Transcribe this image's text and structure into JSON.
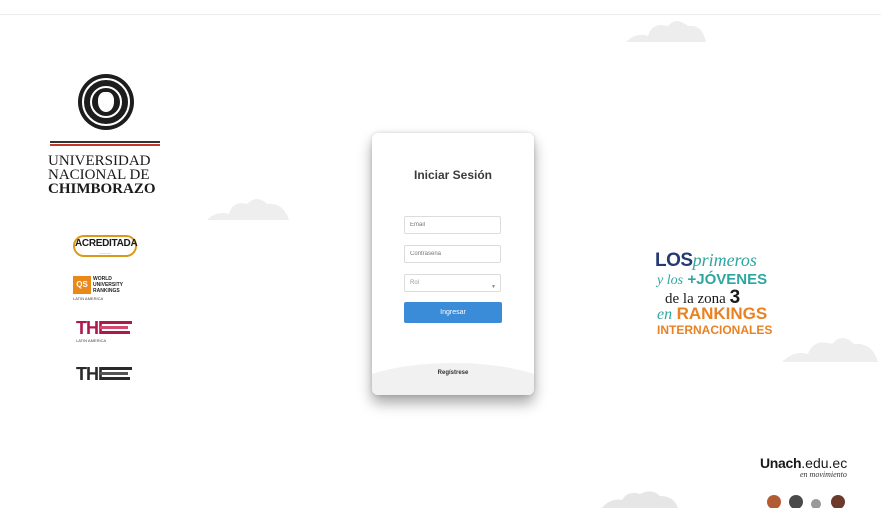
{
  "university": {
    "line1": "UNIVERSIDAD",
    "line2": "NACIONAL DE",
    "line3": "CHIMBORAZO"
  },
  "badges": {
    "acreditada": "ACREDITADA",
    "qs_mark": "QS",
    "qs_line1": "WORLD",
    "qs_line2": "UNIVERSITY",
    "qs_line3": "RANKINGS",
    "qs_region": "LATIN AMERICA",
    "the_mark_1": "THE",
    "the_region": "LATIN AMERICA",
    "the_mark_2": "THE"
  },
  "login": {
    "title": "Iniciar Sesión",
    "email_placeholder": "Email",
    "password_placeholder": "Contraseña",
    "role_placeholder": "Rol",
    "submit_label": "Ingresar",
    "register_label": "Regístrese"
  },
  "slogan": {
    "los": "LOS",
    "primeros": "primeros",
    "y_los": "y los",
    "jovenes": "+JÓVENES",
    "de_la_zona": "de la zona",
    "zona_number": "3",
    "en": "en",
    "rankings": "RANKINGS",
    "internacionales": "INTERNACIONALES"
  },
  "footer_brand": {
    "unach": "Unach",
    "domain": ".edu.ec",
    "tagline": "en movimiento"
  },
  "colors": {
    "primary_button": "#3a8bd8",
    "brand_navy": "#233a72",
    "brand_teal": "#2ea6a0",
    "brand_orange": "#e98222",
    "rule_red": "#c0392b"
  }
}
